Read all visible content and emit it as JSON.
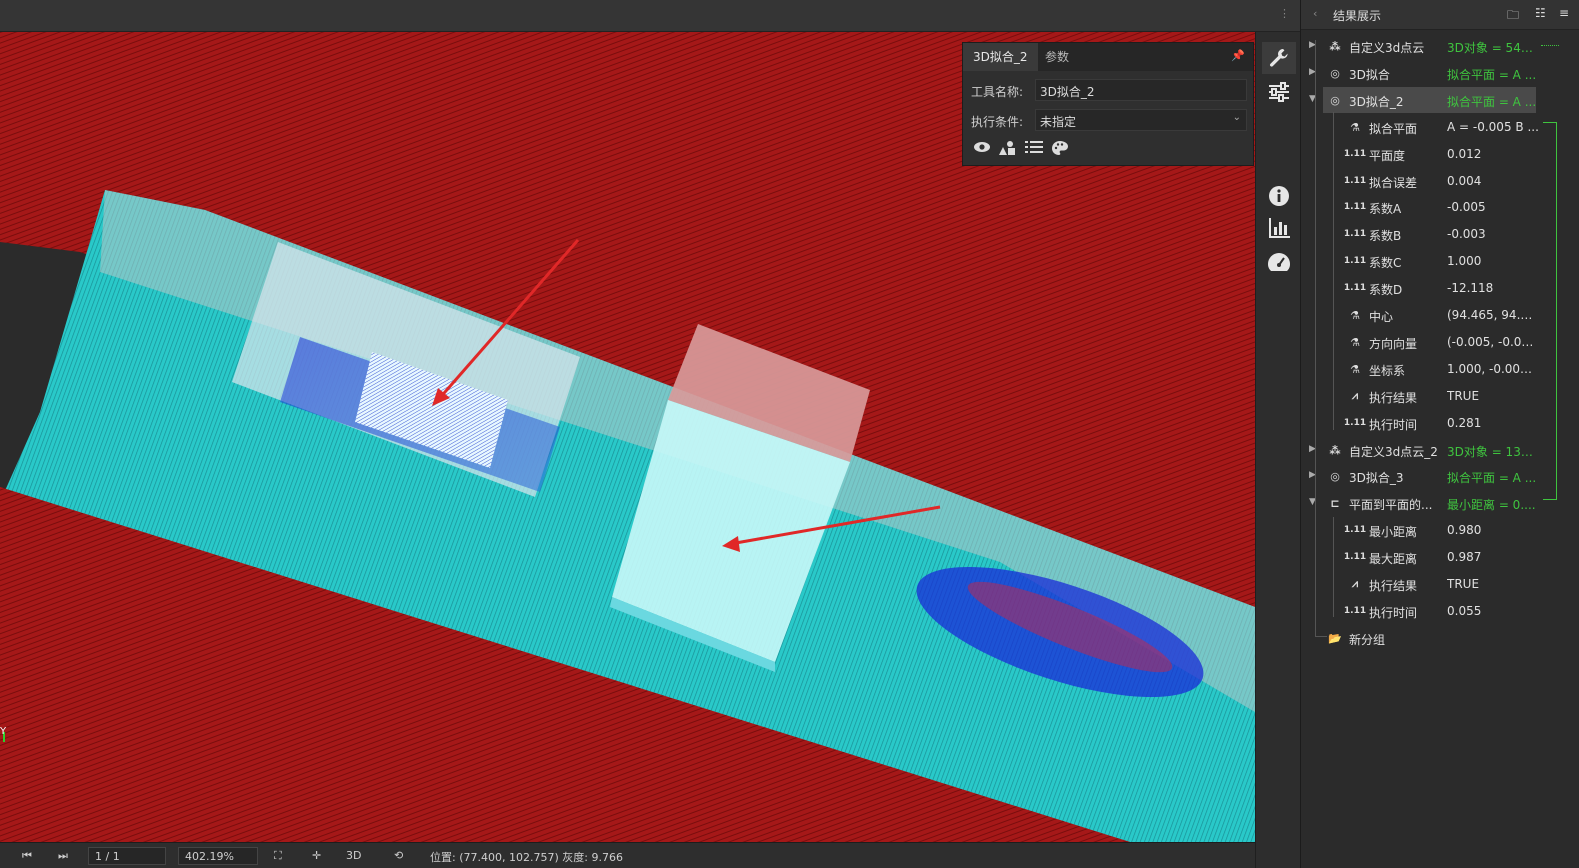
{
  "results_panel": {
    "title": "结果展示",
    "rows": [
      {
        "name": "自定义3d点云",
        "value": "3D对象 = 541...",
        "type": "group"
      },
      {
        "name": "3D拟合",
        "value": "拟合平面 = A ...",
        "type": "group"
      },
      {
        "name": "3D拟合_2",
        "value": "拟合平面 = A ...",
        "type": "group"
      },
      {
        "name": "拟合平面",
        "value": "A = -0.005 B ...",
        "type": "flask"
      },
      {
        "name": "平面度",
        "value": "0.012",
        "type": "num"
      },
      {
        "name": "拟合误差",
        "value": "0.004",
        "type": "num"
      },
      {
        "name": "系数A",
        "value": "-0.005",
        "type": "num"
      },
      {
        "name": "系数B",
        "value": "-0.003",
        "type": "num"
      },
      {
        "name": "系数C",
        "value": "1.000",
        "type": "num"
      },
      {
        "name": "系数D",
        "value": "-12.118",
        "type": "num"
      },
      {
        "name": "中心",
        "value": "(94.465, 94.7...",
        "type": "flask"
      },
      {
        "name": "方向向量",
        "value": "(-0.005, -0.00...",
        "type": "flask"
      },
      {
        "name": "坐标系",
        "value": "1.000, -0.000,...",
        "type": "flask"
      },
      {
        "name": "执行结果",
        "value": "TRUE",
        "type": "bool"
      },
      {
        "name": "执行时间",
        "value": "0.281",
        "type": "num"
      },
      {
        "name": "自定义3d点云_2",
        "value": "3D对象 = 132...",
        "type": "group"
      },
      {
        "name": "3D拟合_3",
        "value": "拟合平面 = A ...",
        "type": "group"
      },
      {
        "name": "平面到平面的...",
        "value": "最小距离 = 0....",
        "type": "group"
      },
      {
        "name": "最小距离",
        "value": "0.980",
        "type": "num"
      },
      {
        "name": "最大距离",
        "value": "0.987",
        "type": "num"
      },
      {
        "name": "执行结果",
        "value": "TRUE",
        "type": "bool"
      },
      {
        "name": "执行时间",
        "value": "0.055",
        "type": "num"
      },
      {
        "name": "新分组",
        "value": "",
        "type": "folder"
      }
    ],
    "num_icon": "1.11"
  },
  "properties_panel": {
    "tab_active": "3D拟合_2",
    "tab_other": "参数",
    "tool_name_label": "工具名称:",
    "tool_name_value": "3D拟合_2",
    "exec_cond_label": "执行条件:",
    "exec_cond_value": "未指定"
  },
  "status_bar": {
    "page": "1 / 1",
    "zoom": "402.19%",
    "mode": "3D",
    "position_text": "位置: (77.400, 102.757)  灰度: 9.766"
  },
  "viewport": {
    "axis_label": "Y"
  },
  "colors": {
    "background": "#8e1414",
    "cloud": "#2ad0d0",
    "plane": "#d89a9a",
    "arrow": "#e02828",
    "accent_green": "#3fc43f"
  }
}
